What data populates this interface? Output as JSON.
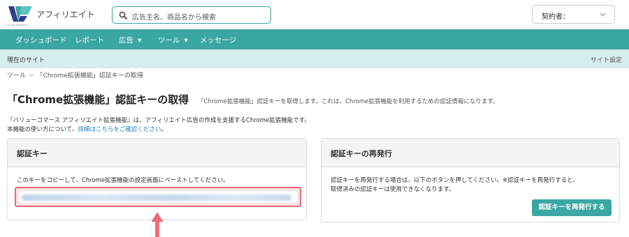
{
  "header": {
    "logo_sub": "VALUECOMMERCE",
    "app_title": "アフィリエイト",
    "search_placeholder": "広告主名、商品名から検索",
    "contract_label": "契約者："
  },
  "nav": {
    "items": [
      {
        "label": "ダッシュボード",
        "has_caret": false
      },
      {
        "label": "レポート",
        "has_caret": false
      },
      {
        "label": "広告",
        "has_caret": true
      },
      {
        "label": "ツール",
        "has_caret": true
      },
      {
        "label": "メッセージ",
        "has_caret": false
      }
    ],
    "caret": "▼"
  },
  "sitebar": {
    "current_site": "現在のサイト",
    "site_settings": "サイト設定"
  },
  "breadcrumb": {
    "items": [
      "ツール",
      "「Chrome拡張機能」認証キーの取得"
    ],
    "separator": ">"
  },
  "page": {
    "title": "「Chrome拡張機能」認証キーの取得",
    "description": "「Chrome拡張機能」認証キーを取得します。これは、Chrome拡張機能を利用するための認証情報になります。",
    "intro_line1": "『バリューコマース アフィリエイト拡張機能』は、アフィリエイト広告の作成を支援するChrome拡張機能です。",
    "intro_line2_prefix": "本機能の使い方について、",
    "intro_link": "詳細はこちらをご確認ください",
    "intro_line2_suffix": "。"
  },
  "auth_panel": {
    "title": "認証キー",
    "instruction": "このキーをコピーして、Chrome拡張機能の設定画面にペーストしてください。"
  },
  "reissue_panel": {
    "title": "認証キーの再発行",
    "text_line1": "認証キーを再発行する場合は、以下のボタンを押してください。※認証キーを再発行すると、",
    "text_line2": "取得済みの認証キーは使用できなくなります。",
    "button_label": "認証キーを再発行する"
  },
  "colors": {
    "brand": "#3aa7a2",
    "sitebar_bg": "#d6edee",
    "link": "#1f7fc0",
    "highlight": "#e86a77"
  },
  "icons": {
    "logo": "valuecommerce-logo-icon",
    "search": "search-icon",
    "chevron": "chevron-down-icon",
    "arrow": "up-arrow-annotation-icon"
  }
}
